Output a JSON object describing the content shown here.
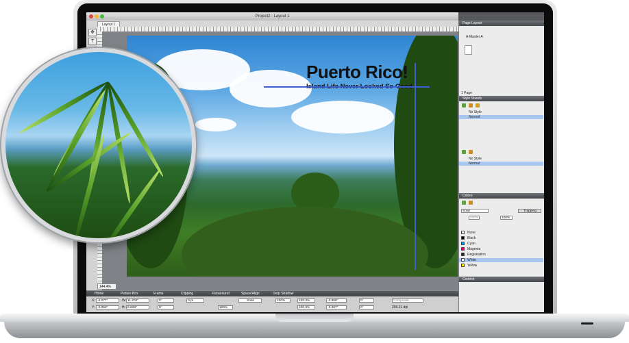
{
  "window": {
    "title": "Project2 : Layout 1",
    "tab_label": "Layout 1",
    "zoom": "144.4%"
  },
  "canvas": {
    "headline": "Puerto Rico!",
    "subheadline": "Island Life Never Looked So Good"
  },
  "measurements": {
    "tabs": [
      "Home",
      "Picture Box",
      "Frame",
      "Clipping",
      "Runaround",
      "Space/Align",
      "Drop Shadow"
    ],
    "x_label": "X:",
    "x_value": "-0.077\"",
    "y_label": "Y:",
    "y_value": "-0.052\"",
    "w_label": "W:",
    "w_value": "11.202\"",
    "h_label": "H:",
    "h_value": "8.629\"",
    "angle1": "0°",
    "angle2": "0°",
    "frame_width": "0 pt",
    "opacity1": "100%",
    "frame_style": "Solid",
    "opacity2": "100%",
    "scale_x": "100.3%",
    "scale_y": "100.3%",
    "offset_x": "-0.869\"",
    "offset_y": "-0.087\"",
    "pic_angle1": "0°",
    "pic_angle2": "0°",
    "color_mode": "Composite",
    "resolution": "299.21 dpi"
  },
  "page_layout": {
    "title": "Page Layout",
    "master": "A-Master A",
    "pages": "1 Page"
  },
  "style_sheets": {
    "title": "Style Sheets",
    "paragraph_styles": [
      "No Style",
      "Normal"
    ],
    "character_styles": [
      "No Style",
      "Normal"
    ]
  },
  "colors_panel": {
    "title": "Colors",
    "fill_type": "Solid",
    "trapping_label": "Trapping",
    "shade": "100%",
    "opacity": "100%",
    "colors": [
      {
        "name": "None",
        "hex": "#ffffff"
      },
      {
        "name": "Black",
        "hex": "#000000"
      },
      {
        "name": "Cyan",
        "hex": "#00a0e6"
      },
      {
        "name": "Magenta",
        "hex": "#e4007c"
      },
      {
        "name": "Registration",
        "hex": "#222222"
      },
      {
        "name": "White",
        "hex": "#ffffff"
      },
      {
        "name": "Yellow",
        "hex": "#ffe600"
      }
    ],
    "selected": "White"
  },
  "content_panel": {
    "title": "Content"
  }
}
